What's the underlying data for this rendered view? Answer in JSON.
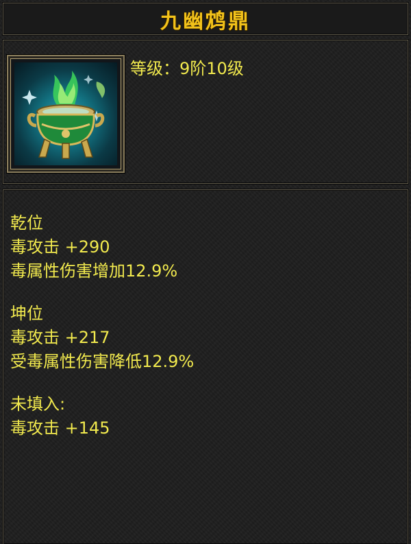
{
  "item": {
    "name": "九幽鸩鼎",
    "level_label": "等级：",
    "level_value": "9阶10级",
    "icon": "poison-cauldron-icon"
  },
  "sections": [
    {
      "title": "乾位",
      "stats": [
        "毒攻击 +290",
        "毒属性伤害增加12.9%"
      ]
    },
    {
      "title": "坤位",
      "stats": [
        "毒攻击 +217",
        "受毒属性伤害降低12.9%"
      ]
    },
    {
      "title": "未填入:",
      "stats": [
        "毒攻击 +145"
      ]
    }
  ],
  "colors": {
    "title": "#f2c21a",
    "text": "#f2ea4e",
    "background": "#1e1e1e",
    "border": "#5e5849"
  }
}
